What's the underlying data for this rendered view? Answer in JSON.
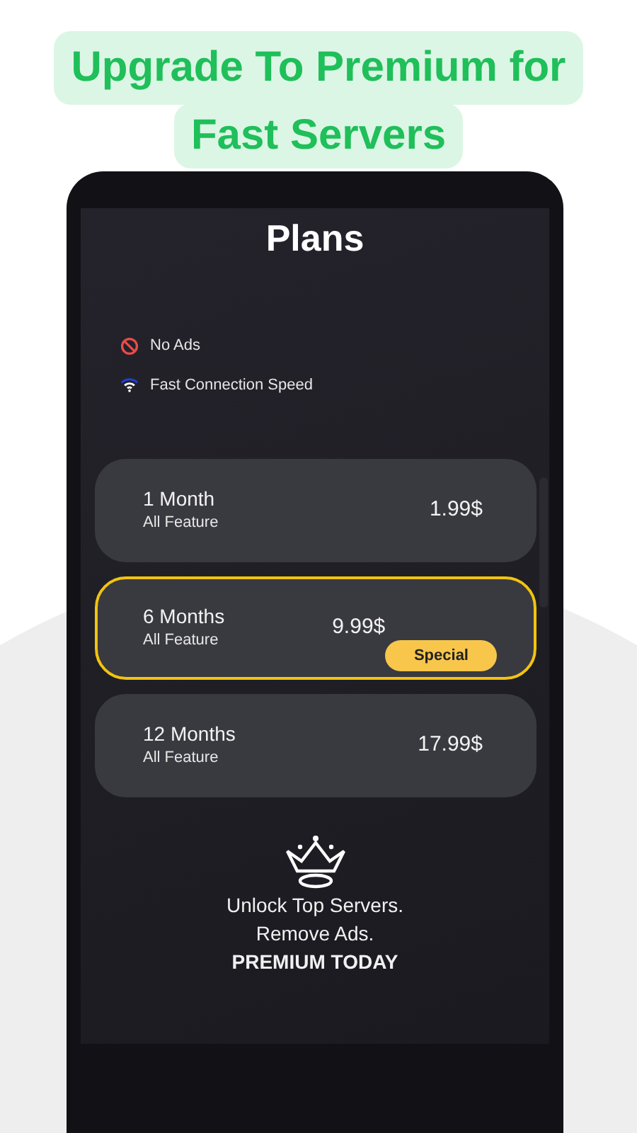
{
  "headline": [
    "Upgrade To Premium for",
    "Fast Servers"
  ],
  "screen": {
    "title": "Plans",
    "features": [
      {
        "kind": "no-ads",
        "label": "No Ads"
      },
      {
        "kind": "wifi",
        "label": "Fast Connection Speed"
      }
    ],
    "plans": [
      {
        "name": "1 Month",
        "subtitle": "All Feature",
        "price": "1.99$",
        "selected": false
      },
      {
        "name": "6 Months",
        "subtitle": "All Feature",
        "price": "9.99$",
        "selected": true,
        "badge": "Special"
      },
      {
        "name": "12 Months",
        "subtitle": "All Feature",
        "price": "17.99$",
        "selected": false
      }
    ],
    "promo": {
      "lines": [
        "Unlock Top Servers.",
        "Remove Ads."
      ],
      "tagline": "PREMIUM TODAY"
    }
  }
}
